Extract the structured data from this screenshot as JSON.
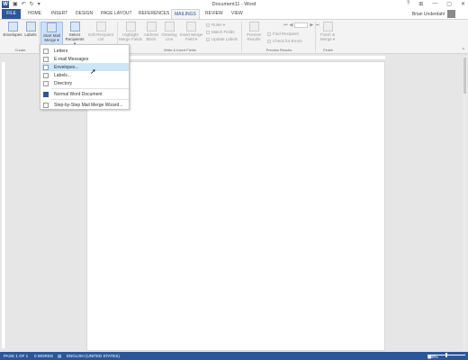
{
  "window": {
    "title": "Document11 - Word",
    "controls": [
      "?",
      "⊞",
      "—",
      "▢",
      "✕"
    ]
  },
  "tabs": [
    "FILE",
    "HOME",
    "INSERT",
    "DESIGN",
    "PAGE LAYOUT",
    "REFERENCES",
    "MAILINGS",
    "REVIEW",
    "VIEW"
  ],
  "active_tab": "MAILINGS",
  "user": {
    "name": "Brian Underdahl"
  },
  "ribbon": {
    "envelopes": "Envelopes",
    "labels": "Labels",
    "start_mail_merge": "Start Mail Merge ▾",
    "select_recipients": "Select Recipients ▾",
    "edit_recipient_list": "Edit Recipient List",
    "highlight_merge_fields": "Highlight Merge Fields",
    "address_block": "Address Block",
    "greeting_line": "Greeting Line",
    "insert_merge_field": "Insert Merge Field ▾",
    "rules": "Rules ▾",
    "match_fields": "Match Fields",
    "update_labels": "Update Labels",
    "preview_results": "Preview Results",
    "find_recipient": "Find Recipient",
    "check_for_errors": "Check for Errors",
    "finish_merge": "Finish & Merge ▾",
    "groups": {
      "create": "Create",
      "write_insert": "Write & Insert Fields",
      "preview": "Preview Results",
      "finish": "Finish"
    }
  },
  "menu": {
    "items": [
      "Letters",
      "E-mail Messages",
      "Envelopes...",
      "Labels...",
      "Directory",
      "Normal Word Document",
      "Step-by-Step Mail Merge Wizard..."
    ],
    "hovered": "Envelopes..."
  },
  "status": {
    "page": "PAGE 1 OF 1",
    "words": "0 WORDS",
    "language": "ENGLISH (UNITED STATES)",
    "zoom": "100%",
    "zoom_level_percent": 100
  }
}
